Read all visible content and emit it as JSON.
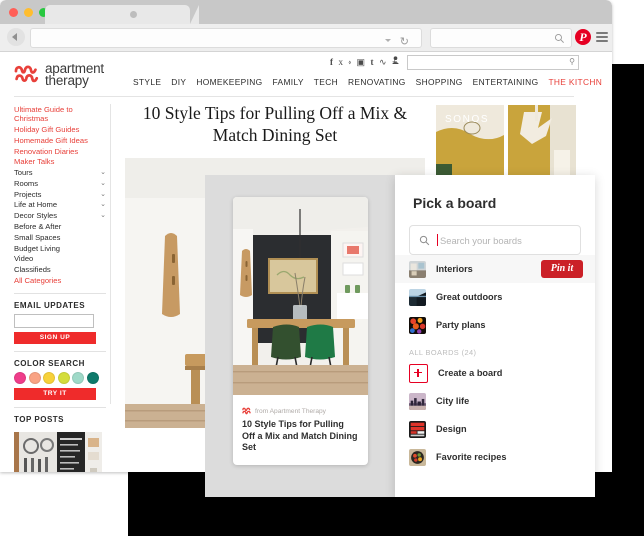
{
  "browser": {
    "tab_title": "",
    "url_value": "",
    "url_placeholder": "",
    "search_placeholder": "",
    "pinterest_button_label": "P",
    "reload_icon": "reload-icon",
    "back_icon": "back-arrow-icon",
    "menu_icon": "hamburger-menu-icon"
  },
  "site": {
    "logo_line1": "apartment",
    "logo_line2": "therapy",
    "social_icons": [
      "f",
      "ᑕ",
      "ᴠ",
      "▣",
      "t",
      "⤳",
      "+"
    ],
    "search_value": "",
    "nav": [
      {
        "label": "STYLE",
        "accent": false
      },
      {
        "label": "DIY",
        "accent": false
      },
      {
        "label": "HOMEKEEPING",
        "accent": false
      },
      {
        "label": "FAMILY",
        "accent": false
      },
      {
        "label": "TECH",
        "accent": false
      },
      {
        "label": "RENOVATING",
        "accent": false
      },
      {
        "label": "SHOPPING",
        "accent": false
      },
      {
        "label": "ENTERTAINING",
        "accent": false
      },
      {
        "label": "THE KITCHN",
        "accent": true
      }
    ]
  },
  "sidebar": {
    "links": [
      {
        "label": "Ultimate Guide to Christmas",
        "red": true,
        "chevron": false
      },
      {
        "label": "Holiday Gift Guides",
        "red": true,
        "chevron": false
      },
      {
        "label": "Homemade Gift Ideas",
        "red": true,
        "chevron": false
      },
      {
        "label": "Renovation Diaries",
        "red": true,
        "chevron": false
      },
      {
        "label": "Maker Talks",
        "red": true,
        "chevron": false
      },
      {
        "label": "Tours",
        "red": false,
        "chevron": true
      },
      {
        "label": "Rooms",
        "red": false,
        "chevron": true
      },
      {
        "label": "Projects",
        "red": false,
        "chevron": true
      },
      {
        "label": "Life at Home",
        "red": false,
        "chevron": true
      },
      {
        "label": "Decor Styles",
        "red": false,
        "chevron": true
      },
      {
        "label": "Before & After",
        "red": false,
        "chevron": false
      },
      {
        "label": "Small Spaces",
        "red": false,
        "chevron": false
      },
      {
        "label": "Budget Living",
        "red": false,
        "chevron": false
      },
      {
        "label": "Video",
        "red": false,
        "chevron": false
      },
      {
        "label": "Classifieds",
        "red": false,
        "chevron": false
      },
      {
        "label": "All Categories",
        "red": true,
        "chevron": false
      }
    ],
    "email_heading": "EMAIL UPDATES",
    "email_value": "",
    "signup_label": "SIGN UP",
    "color_heading": "COLOR SEARCH",
    "swatches": [
      "#ef3d8a",
      "#f9a384",
      "#f7d13a",
      "#d4dd3c",
      "#9fd9c8",
      "#0e7a6b"
    ],
    "tryit_label": "TRY IT",
    "topposts_heading": "TOP POSTS"
  },
  "article": {
    "headline": "10 Style Tips for Pulling Off a Mix & Match Dining Set"
  },
  "ad": {
    "brand": "SONOS"
  },
  "pin_preview": {
    "source_label": "from Apartment Therapy",
    "title": "10 Style Tips for Pulling Off a Mix and Match Dining Set"
  },
  "pin_modal": {
    "title": "Pick a board",
    "search_value": "",
    "search_placeholder": "Search your boards",
    "pinit_label": "Pin it",
    "top_boards": [
      {
        "name": "Interiors",
        "selected": true
      },
      {
        "name": "Great outdoors",
        "selected": false
      },
      {
        "name": "Party plans",
        "selected": false
      }
    ],
    "all_boards_heading": "ALL BOARDS (24)",
    "all_boards": [
      {
        "name": "Create a board",
        "is_create": true
      },
      {
        "name": "City life",
        "is_create": false
      },
      {
        "name": "Design",
        "is_create": false
      },
      {
        "name": "Favorite recipes",
        "is_create": false
      }
    ]
  },
  "colors": {
    "brand_red": "#e60023",
    "accent_red": "#e8403a",
    "pinit_red": "#cb2027"
  }
}
